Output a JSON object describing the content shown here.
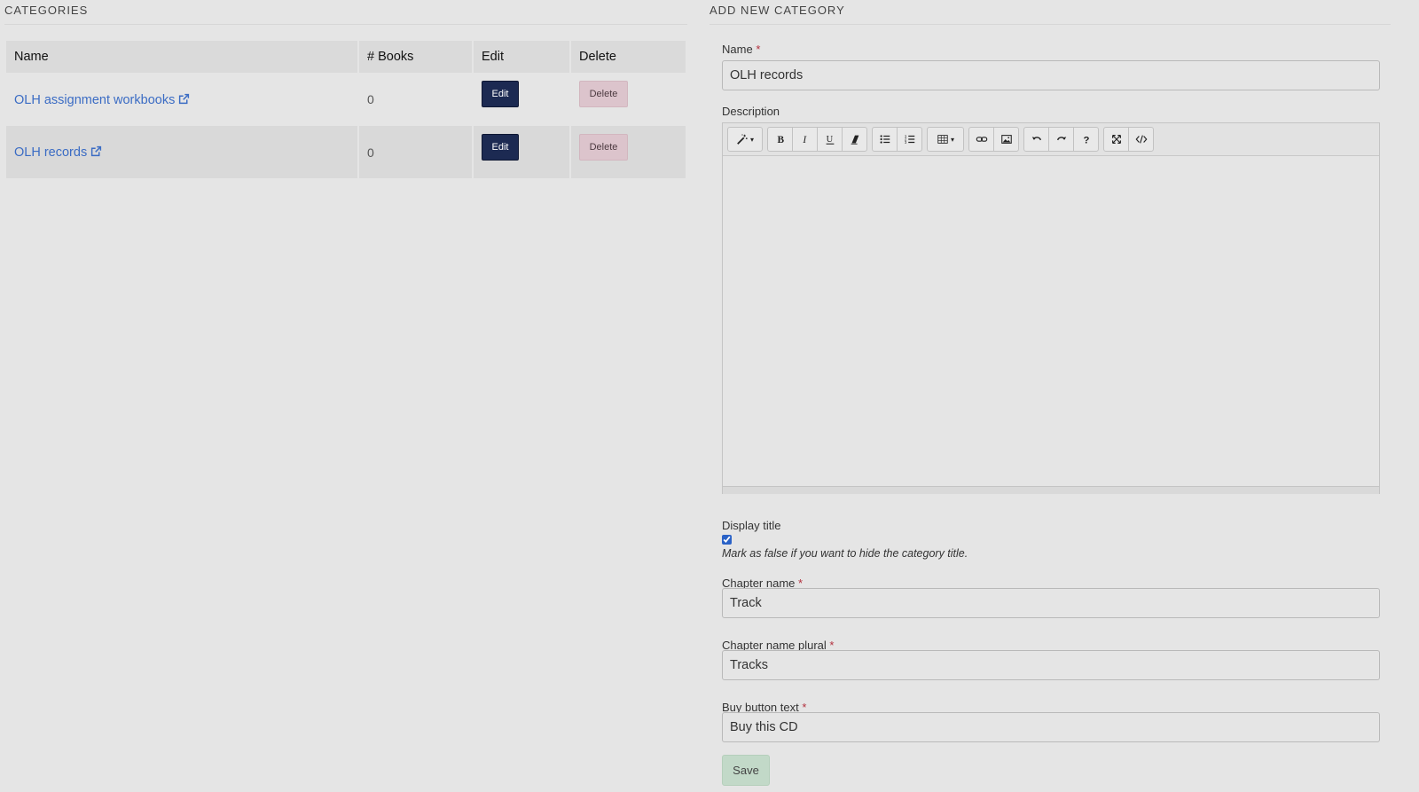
{
  "categories_panel": {
    "title": "CATEGORIES",
    "columns": [
      "Name",
      "# Books",
      "Edit",
      "Delete"
    ],
    "rows": [
      {
        "name": "OLH assignment workbooks",
        "books": "0",
        "edit": "Edit",
        "delete": "Delete"
      },
      {
        "name": "OLH records",
        "books": "0",
        "edit": "Edit",
        "delete": "Delete"
      }
    ]
  },
  "form": {
    "title": "ADD NEW CATEGORY",
    "name": {
      "label": "Name",
      "required": "*",
      "value": "OLH records"
    },
    "description": {
      "label": "Description"
    },
    "toolbar_icons": [
      "magic-wand-icon",
      "bold-icon",
      "italic-icon",
      "underline-icon",
      "eraser-icon",
      "bullet-list-icon",
      "numbered-list-icon",
      "table-icon",
      "link-icon",
      "image-icon",
      "undo-icon",
      "redo-icon",
      "help-icon",
      "fullscreen-icon",
      "code-view-icon"
    ],
    "display_title": {
      "label": "Display title",
      "checked": true,
      "help": "Mark as false if you want to hide the category title."
    },
    "chapter_name": {
      "label": "Chapter name",
      "required": "*",
      "value": "Track"
    },
    "chapter_name_plural": {
      "label": "Chapter name plural",
      "required": "*",
      "value": "Tracks"
    },
    "buy_button_text": {
      "label": "Buy button text",
      "required": "*",
      "value": "Buy this CD"
    },
    "save_label": "Save"
  },
  "colors": {
    "background": "#e5e5e5",
    "link": "#3b6cc4",
    "edit_button": "#1c2a52",
    "delete_button": "#dcc4cc",
    "save_button": "#c2d9c8",
    "required": "#b3313e"
  }
}
